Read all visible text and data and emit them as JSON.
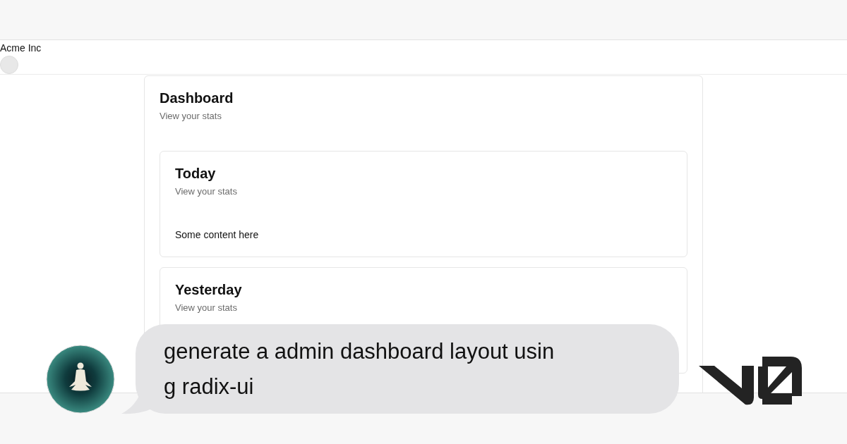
{
  "header": {
    "brand": "Acme Inc"
  },
  "dashboard": {
    "title": "Dashboard",
    "subtitle": "View your stats",
    "cards": [
      {
        "title": "Today",
        "subtitle": "View your stats",
        "content": "Some content here"
      },
      {
        "title": "Yesterday",
        "subtitle": "View your stats"
      }
    ]
  },
  "prompt": {
    "lines": [
      "generate a admin dashboard layout usin",
      "g radix-ui"
    ]
  }
}
